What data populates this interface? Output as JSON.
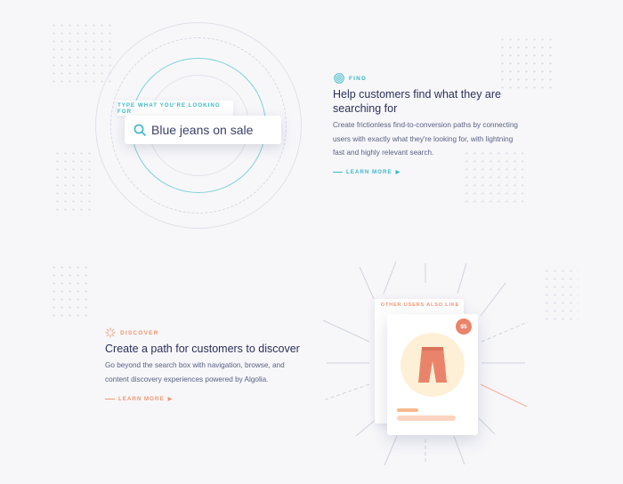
{
  "find": {
    "kicker": "FIND",
    "search_label": "TYPE WHAT YOU'RE LOOKING FOR",
    "search_query": "Blue jeans on sale",
    "title": "Help customers find what they are searching for",
    "description": "Create frictionless find-to-conversion paths by connecting users with exactly what they're looking for, with lightning fast and highly relevant search.",
    "learn_more": "LEARN MORE",
    "accent": "#3cb8c6"
  },
  "discover": {
    "kicker": "DISCOVER",
    "card_label": "OTHER USERS ALSO LIKE",
    "price": "$5",
    "title": "Create a path for customers to discover",
    "description": "Go beyond the search box with navigation, browse, and content discovery experiences powered by Algolia.",
    "learn_more": "LEARN MORE",
    "accent": "#f0956e"
  }
}
